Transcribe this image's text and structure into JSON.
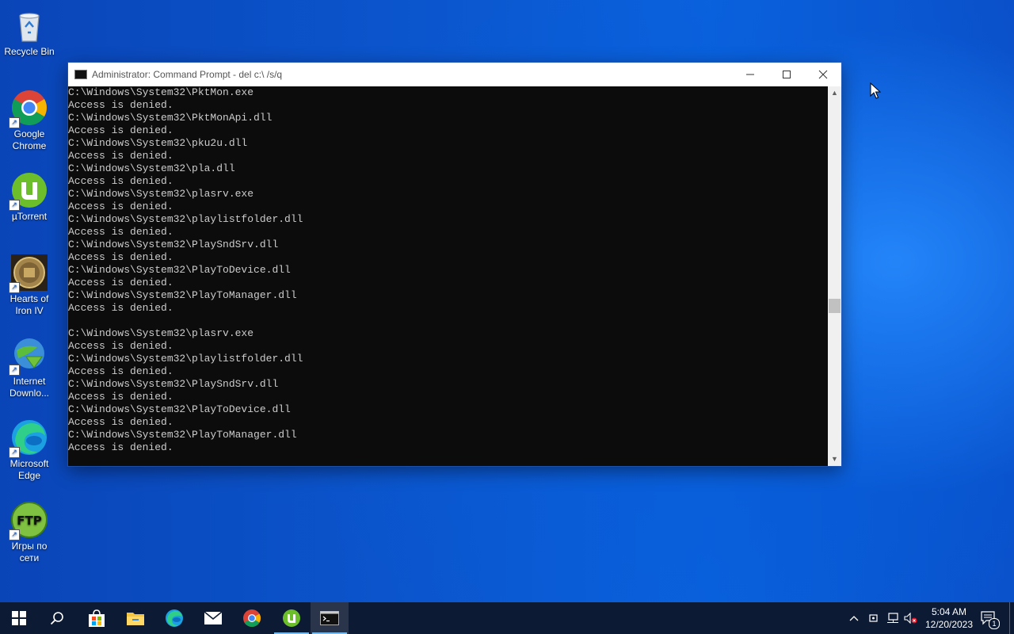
{
  "desktop": {
    "icons": [
      {
        "label": "Recycle Bin"
      },
      {
        "label": "Google Chrome"
      },
      {
        "label": "µTorrent"
      },
      {
        "label": "Hearts of Iron IV"
      },
      {
        "label": "Internet Downlo..."
      },
      {
        "label": "Microsoft Edge"
      },
      {
        "label": "Игры по сети"
      }
    ]
  },
  "window": {
    "title": "Administrator: Command Prompt - del  c:\\ /s/q",
    "minimize_glyph": "—",
    "maximize_glyph": "☐",
    "close_glyph": "✕",
    "console_lines": [
      "C:\\Windows\\System32\\PktMon.exe",
      "Access is denied.",
      "C:\\Windows\\System32\\PktMonApi.dll",
      "Access is denied.",
      "C:\\Windows\\System32\\pku2u.dll",
      "Access is denied.",
      "C:\\Windows\\System32\\pla.dll",
      "Access is denied.",
      "C:\\Windows\\System32\\plasrv.exe",
      "Access is denied.",
      "C:\\Windows\\System32\\playlistfolder.dll",
      "Access is denied.",
      "C:\\Windows\\System32\\PlaySndSrv.dll",
      "Access is denied.",
      "C:\\Windows\\System32\\PlayToDevice.dll",
      "Access is denied.",
      "C:\\Windows\\System32\\PlayToManager.dll",
      "Access is denied.",
      "",
      "C:\\Windows\\System32\\plasrv.exe",
      "Access is denied.",
      "C:\\Windows\\System32\\playlistfolder.dll",
      "Access is denied.",
      "C:\\Windows\\System32\\PlaySndSrv.dll",
      "Access is denied.",
      "C:\\Windows\\System32\\PlayToDevice.dll",
      "Access is denied.",
      "C:\\Windows\\System32\\PlayToManager.dll",
      "Access is denied."
    ]
  },
  "taskbar": {
    "items": [
      "start-icon",
      "search-icon",
      "store-icon",
      "file-explorer-icon",
      "edge-icon",
      "mail-icon",
      "chrome-icon",
      "utorrent-icon",
      "command-prompt-icon"
    ],
    "active_items": [
      "utorrent-icon",
      "command-prompt-icon"
    ],
    "clock": {
      "time": "5:04 AM",
      "date": "12/20/2023"
    },
    "notification_count": "1",
    "accent_color": "#76b9ed"
  }
}
